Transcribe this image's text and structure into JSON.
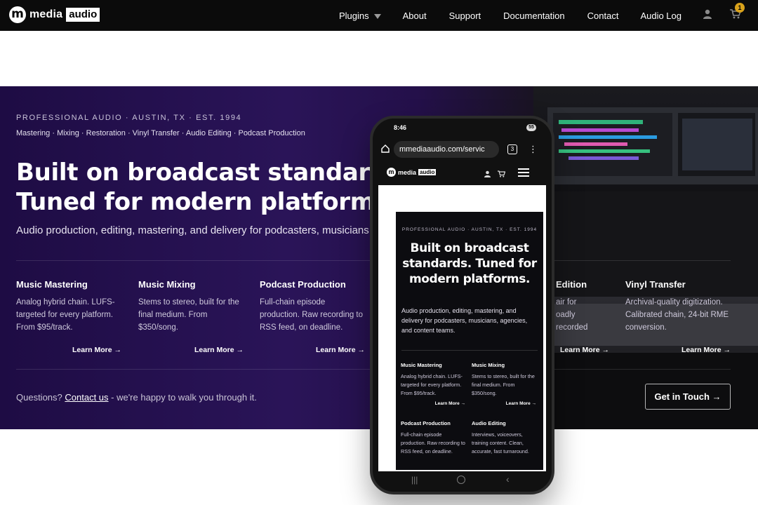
{
  "brand": {
    "mark": "m",
    "word1": "media",
    "word2": "audio"
  },
  "nav": {
    "items": [
      {
        "label": "Plugins",
        "has_dropdown": true
      },
      {
        "label": "About"
      },
      {
        "label": "Support"
      },
      {
        "label": "Documentation"
      },
      {
        "label": "Contact"
      },
      {
        "label": "Audio Log"
      }
    ],
    "account_icon": "user-icon",
    "cart_icon": "cart-icon",
    "cart_count": "1"
  },
  "hero": {
    "kicker": "PROFESSIONAL AUDIO · AUSTIN, TX · EST. 1994",
    "services_line": "Mastering · Mixing · Restoration · Vinyl Transfer · Audio Editing · Podcast Production",
    "headline_1": "Built on broadcast standards.",
    "headline_2": "Tuned for modern platforms.",
    "subline": "Audio production, editing, mastering, and delivery for podcasters, musicians, agen",
    "services": [
      {
        "title": "Music Mastering",
        "desc": "Analog hybrid chain. LUFS-targeted for every platform. From $95/track.",
        "more": "Learn More →"
      },
      {
        "title": "Music Mixing",
        "desc": "Stems to stereo, built for the final medium. From $350/song.",
        "more": "Learn More →"
      },
      {
        "title": "Podcast Production",
        "desc": "Full-chain episode production. Raw recording to RSS feed, on deadline.",
        "more": "Learn More →"
      },
      {
        "title": "Edition",
        "desc": "air for\noadly recorded",
        "more": "Learn More →"
      },
      {
        "title": "Vinyl Transfer",
        "desc": "Archival-quality digitization. Calibrated chain, 24-bit RME conversion.",
        "more": "Learn More →"
      }
    ],
    "questions_prefix": "Questions? ",
    "questions_link": "Contact us",
    "questions_suffix": " - we're happy to walk you through it.",
    "cta": "Get in Touch →"
  },
  "phone": {
    "time": "8:46",
    "battery": "55",
    "url": "mmediaaudio.com/servic",
    "tab_count": "3",
    "site_word1": "media",
    "site_word2": "audio",
    "kicker": "PROFESSIONAL AUDIO · AUSTIN, TX · EST. 1994",
    "headline": "Built on broadcast standards. Tuned for modern platforms.",
    "sub": "Audio production, editing, mastering, and delivery for podcasters, musicians, agencies, and content teams.",
    "services": [
      {
        "title": "Music Mastering",
        "desc": "Analog hybrid chain. LUFS-targeted for every platform. From $95/track.",
        "more": "Learn More →"
      },
      {
        "title": "Music Mixing",
        "desc": "Stems to stereo, built for the final medium. From $350/song.",
        "more": "Learn More →"
      },
      {
        "title": "Podcast Production",
        "desc": "Full-chain episode production. Raw recording to RSS feed, on deadline."
      },
      {
        "title": "Audio Editing",
        "desc": "Interviews, voiceovers, training content. Clean, accurate, fast turnaround."
      }
    ]
  }
}
